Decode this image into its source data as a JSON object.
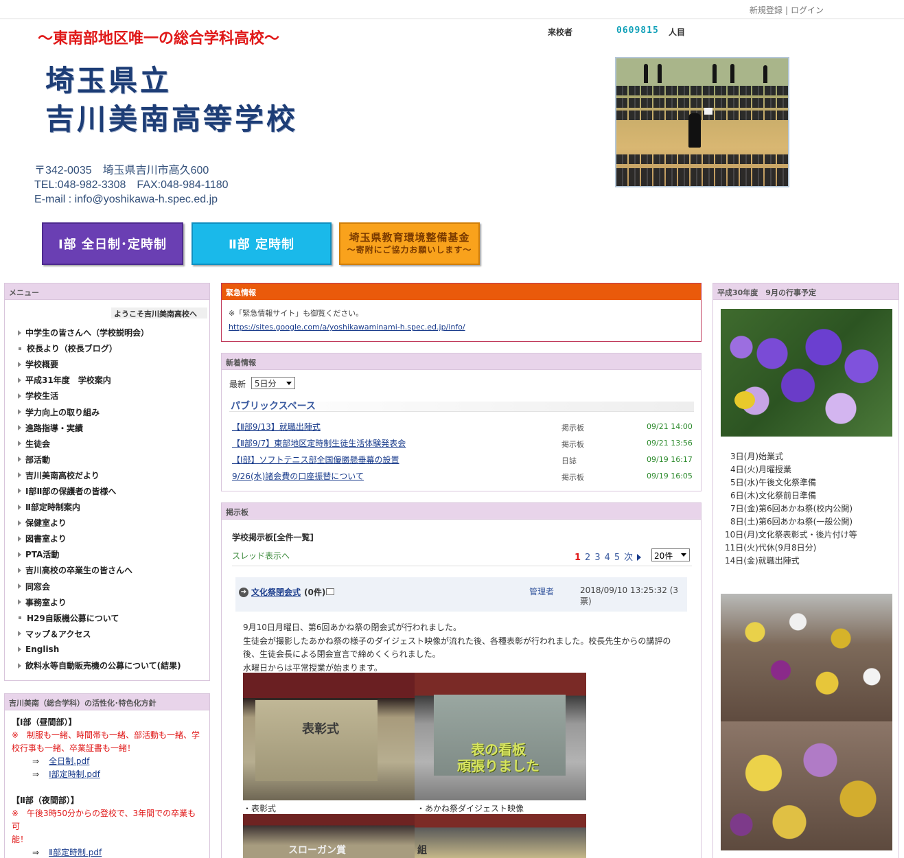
{
  "topbar": {
    "register": "新規登録",
    "separator": "|",
    "login": "ログイン"
  },
  "header": {
    "tagline": "～東南部地区唯一の総合学科高校～",
    "name_line1": "埼玉県立",
    "name_line2": "吉川美南高等学校",
    "address": "〒342-0035　埼玉県吉川市高久600",
    "tel_fax": "TEL:048-982-3308　FAX:048-984-1180",
    "email": "E-mail : info@yoshikawa-h.spec.ed.jp",
    "visitor_label": "来校者",
    "visitor_count": "0609815",
    "visitor_unit": "人目"
  },
  "buttons": {
    "part1": "Ⅰ部 全日制･定時制",
    "part2": "Ⅱ部 定時制",
    "fund_line1": "埼玉県教育環境整備基金",
    "fund_line2": "～寄附にご協力お願いします～"
  },
  "menu": {
    "head": "メニュー",
    "welcome": "ようこそ吉川美南高校へ",
    "items": [
      {
        "label": "中学生の皆さんへ（学校説明会）",
        "marker": "tri"
      },
      {
        "label": "校長より（校長ブログ）",
        "marker": "dot"
      },
      {
        "label": "学校概要",
        "marker": "tri"
      },
      {
        "label": "平成31年度　学校案内",
        "marker": "tri"
      },
      {
        "label": "学校生活",
        "marker": "tri"
      },
      {
        "label": "学力向上の取り組み",
        "marker": "tri"
      },
      {
        "label": "進路指導・実績",
        "marker": "tri"
      },
      {
        "label": "生徒会",
        "marker": "tri"
      },
      {
        "label": "部活動",
        "marker": "tri"
      },
      {
        "label": "吉川美南高校だより",
        "marker": "tri"
      },
      {
        "label": "Ⅰ部Ⅱ部の保護者の皆様へ",
        "marker": "tri"
      },
      {
        "label": "Ⅱ部定時制案内",
        "marker": "tri"
      },
      {
        "label": "保健室より",
        "marker": "tri"
      },
      {
        "label": "図書室より",
        "marker": "tri"
      },
      {
        "label": "PTA活動",
        "marker": "tri"
      },
      {
        "label": "吉川高校の卒業生の皆さんへ",
        "marker": "tri"
      },
      {
        "label": "同窓会",
        "marker": "tri"
      },
      {
        "label": "事務室より",
        "marker": "tri"
      },
      {
        "label": "H29自販機公募について",
        "marker": "dot"
      },
      {
        "label": "マップ＆アクセス",
        "marker": "tri"
      },
      {
        "label": "English",
        "marker": "tri"
      },
      {
        "label": "飲料水等自動販売機の公募について(結果)",
        "marker": "tri"
      }
    ]
  },
  "policy": {
    "head": "吉川美南（総合学科）の活性化･特色化方針",
    "part1_title": "【Ⅰ部（昼間部）】",
    "part1_note_1": "※　制服も一緒、時間帯も一緒、部活動も一緒、学",
    "part1_note_2": "校行事も一緒、卒業証書も一緒！",
    "arrow": "⇒",
    "link_full": "全日制.pdf",
    "link_part1": "Ⅰ部定時制.pdf",
    "part2_title": "【Ⅱ部（夜間部）】",
    "part2_note_1": "※　午後3時50分からの登校で、3年間での卒業も可",
    "part2_note_2": "能！",
    "link_part2": "Ⅱ部定時制.pdf"
  },
  "emergency": {
    "head": "緊急情報",
    "note": "※「緊急情報サイト」も御覧ください。",
    "url": "https://sites.google.com/a/yoshikawaminami-h.spec.ed.jp/info/"
  },
  "news": {
    "head": "新着情報",
    "latest_label": "最新",
    "latest_value": "5日分",
    "space": "パブリックスペース",
    "rows": [
      {
        "title": "【Ⅱ部9/13】就職出陣式",
        "cat": "掲示板",
        "date": "09/21 14:00"
      },
      {
        "title": "【Ⅱ部9/7】東部地区定時制生徒生活体験発表会",
        "cat": "掲示板",
        "date": "09/21 13:56"
      },
      {
        "title": "【Ⅰ部】ソフトテニス部全国優勝懸垂幕の設置",
        "cat": "日誌",
        "date": "09/19 16:17"
      },
      {
        "title": "9/26(水)諸会費の口座振替について",
        "cat": "掲示板",
        "date": "09/19 16:05"
      }
    ]
  },
  "board": {
    "head": "掲示板",
    "title": "学校掲示板[全件一覧]",
    "thread_link": "スレッド表示へ",
    "pages": [
      "1",
      "2",
      "3",
      "4",
      "5"
    ],
    "next": "次",
    "per_page": "20件",
    "post": {
      "title": "文化祭閉会式",
      "count": "(0件)",
      "author": "管理者",
      "date": "2018/09/10 13:25:32 (3票)",
      "body": [
        "9月10日月曜日、第6回あかね祭の閉会式が行われました。",
        "生徒会が撮影したあかね祭の様子のダイジェスト映像が流れた後、各種表彰が行われました。校長先生からの講評の",
        "後、生徒会長による閉会宣言で締めくくられました。",
        "水曜日からは平常授業が始まります。"
      ],
      "img1_text": "表彰式",
      "img2_text_1": "表の看板",
      "img2_text_2": "頑張りました",
      "caption1": "・表彰式",
      "caption2": "・あかね祭ダイジェスト映像",
      "img3_text": "スローガン賞",
      "img4_text": "組"
    }
  },
  "events": {
    "head": "平成30年度　9月の行事予定",
    "items": [
      "3日(月)始業式",
      "4日(火)月曜授業",
      "5日(水)午後文化祭準備",
      "6日(木)文化祭前日準備",
      "7日(金)第6回あかね祭(校内公開)",
      "8日(土)第6回あかね祭(一般公開)",
      "10日(月)文化祭表彰式・後片付け等",
      "11日(火)代休(9月8日分)",
      "14日(金)就職出陣式"
    ]
  }
}
